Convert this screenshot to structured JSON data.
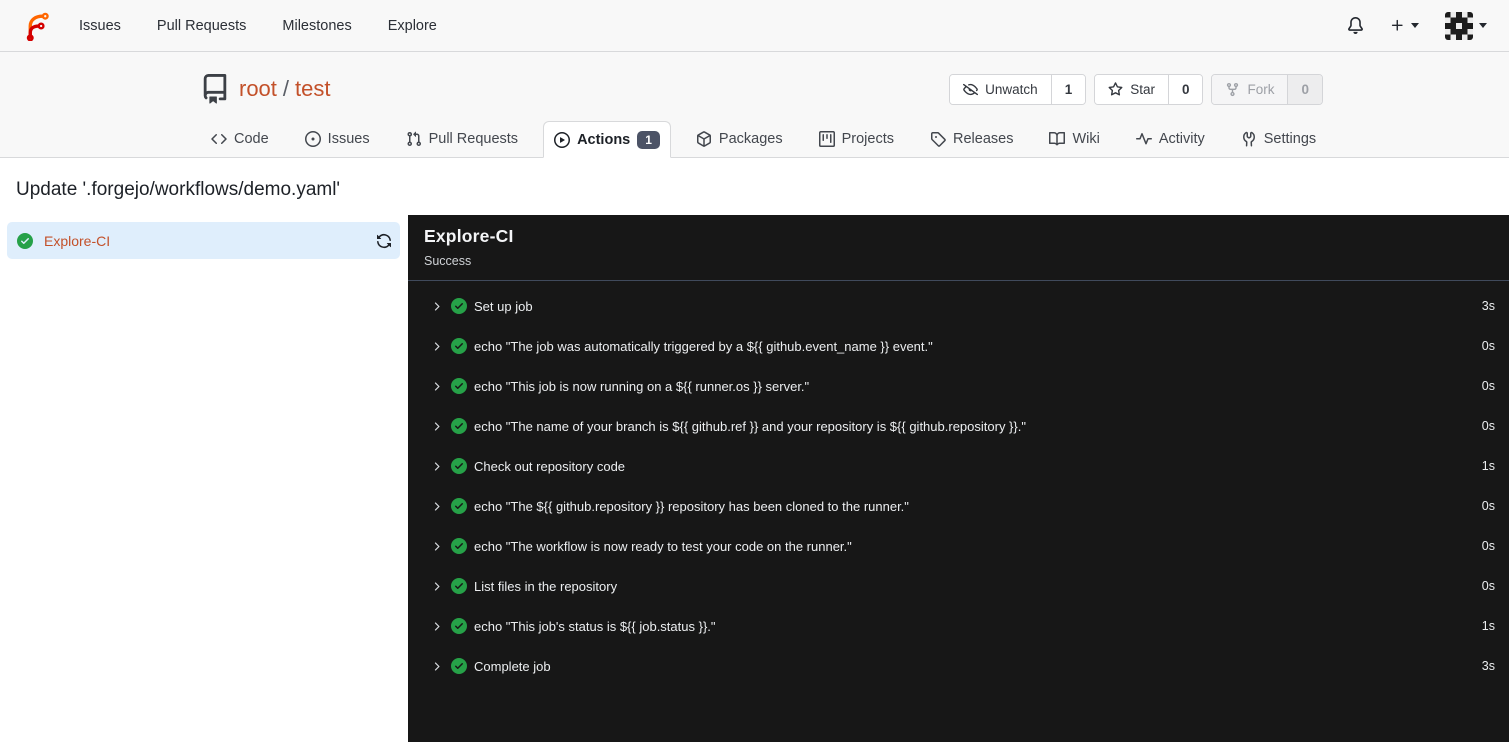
{
  "navbar": {
    "links": [
      {
        "label": "Issues"
      },
      {
        "label": "Pull Requests"
      },
      {
        "label": "Milestones"
      },
      {
        "label": "Explore"
      }
    ]
  },
  "repo": {
    "owner": "root",
    "separator": "/",
    "name": "test",
    "buttons": {
      "unwatch": {
        "label": "Unwatch",
        "count": "1"
      },
      "star": {
        "label": "Star",
        "count": "0"
      },
      "fork": {
        "label": "Fork",
        "count": "0"
      }
    },
    "tabs": [
      {
        "label": "Code"
      },
      {
        "label": "Issues"
      },
      {
        "label": "Pull Requests"
      },
      {
        "label": "Actions",
        "badge": "1"
      },
      {
        "label": "Packages"
      },
      {
        "label": "Projects"
      },
      {
        "label": "Releases"
      },
      {
        "label": "Wiki"
      },
      {
        "label": "Activity"
      },
      {
        "label": "Settings"
      }
    ]
  },
  "page": {
    "title": "Update '.forgejo/workflows/demo.yaml'"
  },
  "run": {
    "job": {
      "name": "Explore-CI"
    },
    "panel": {
      "title": "Explore-CI",
      "status": "Success"
    },
    "steps": [
      {
        "title": "Set up job",
        "duration": "3s"
      },
      {
        "title": "echo \"The job was automatically triggered by a ${{ github.event_name }} event.\"",
        "duration": "0s"
      },
      {
        "title": "echo \"This job is now running on a ${{ runner.os }} server.\"",
        "duration": "0s"
      },
      {
        "title": "echo \"The name of your branch is ${{ github.ref }} and your repository is ${{ github.repository }}.\"",
        "duration": "0s"
      },
      {
        "title": "Check out repository code",
        "duration": "1s"
      },
      {
        "title": "echo \"The ${{ github.repository }} repository has been cloned to the runner.\"",
        "duration": "0s"
      },
      {
        "title": "echo \"The workflow is now ready to test your code on the runner.\"",
        "duration": "0s"
      },
      {
        "title": "List files in the repository",
        "duration": "0s"
      },
      {
        "title": "echo \"This job's status is ${{ job.status }}.\"",
        "duration": "1s"
      },
      {
        "title": "Complete job",
        "duration": "3s"
      }
    ]
  },
  "colors": {
    "accent": "#c3512a",
    "green": "#26a148",
    "header_bg": "#f8f8f8",
    "border": "#d8d9db",
    "panel_bg": "#171717",
    "panel_divider": "#404a5c",
    "selected_bg": "#dfeefc",
    "badge_bg": "#4c5366"
  }
}
